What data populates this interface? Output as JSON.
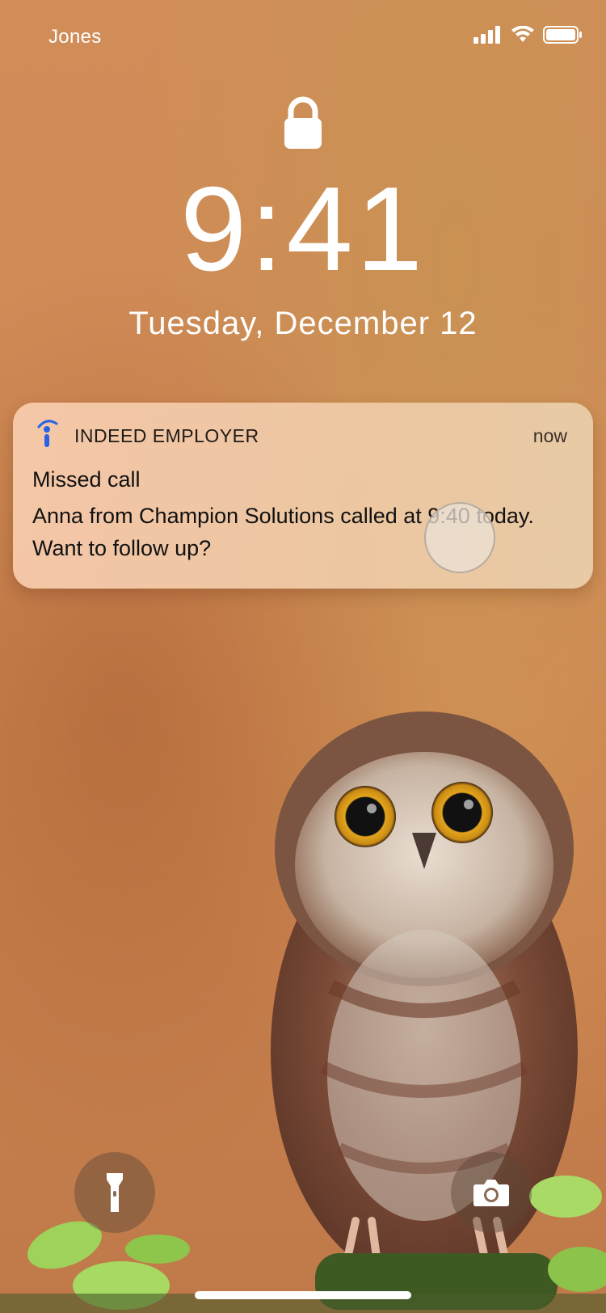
{
  "status_bar": {
    "carrier": "Jones",
    "icons": [
      "cellular-signal-icon",
      "wifi-icon",
      "battery-icon"
    ]
  },
  "lock_screen": {
    "lock_icon": "lock-icon",
    "time": "9:41",
    "date": "Tuesday, December 12"
  },
  "notification": {
    "app_icon": "indeed-logo-icon",
    "app_name": "INDEED EMPLOYER",
    "time": "now",
    "title": "Missed call",
    "body": "Anna from Champion Solutions called at 9:40 today. Want to follow up?"
  },
  "quick_actions": {
    "flashlight_icon": "flashlight-icon",
    "camera_icon": "camera-icon"
  },
  "colors": {
    "notification_bg": "#f2cba8",
    "accent_indeed_blue": "#2a62e6",
    "text_primary": "#111111",
    "text_white": "#ffffff"
  }
}
